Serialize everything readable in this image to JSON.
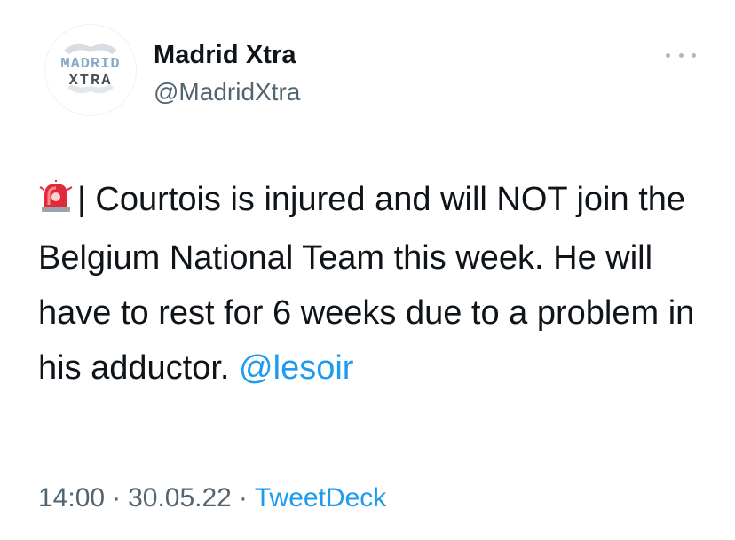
{
  "tweet": {
    "author": {
      "name": "Madrid Xtra",
      "handle": "@MadridXtra",
      "avatar_text_top": "MADRID",
      "avatar_text_bottom": "XTRA"
    },
    "text_before_mention": "| Courtois is injured and will NOT join the Belgium National Team this week. He will have to rest for 6 weeks due to a problem in his adductor.",
    "mention": "@lesoir",
    "emoji": "police-car-light-icon",
    "time": "14:00",
    "date": "30.05.22",
    "separator": "·",
    "source": "TweetDeck"
  },
  "colors": {
    "link": "#1d9bf0",
    "secondary_text": "#536471",
    "primary_text": "#0f1419",
    "siren_red": "#e0293a"
  }
}
